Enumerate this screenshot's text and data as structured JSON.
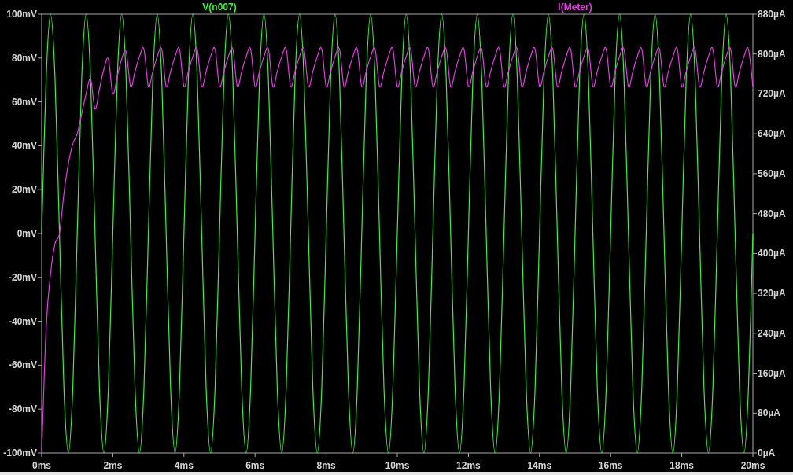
{
  "plot": {
    "chart_data": {
      "type": "line",
      "xlim": [
        0,
        20
      ],
      "xticks": [
        {
          "value": 0,
          "label": "0ms"
        },
        {
          "value": 2,
          "label": "2ms"
        },
        {
          "value": 4,
          "label": "4ms"
        },
        {
          "value": 6,
          "label": "6ms"
        },
        {
          "value": 8,
          "label": "8ms"
        },
        {
          "value": 10,
          "label": "10ms"
        },
        {
          "value": 12,
          "label": "12ms"
        },
        {
          "value": 14,
          "label": "14ms"
        },
        {
          "value": 16,
          "label": "16ms"
        },
        {
          "value": 18,
          "label": "18ms"
        },
        {
          "value": 20,
          "label": "20ms"
        }
      ],
      "ylim": [
        -100,
        100
      ],
      "yticks": [
        {
          "value": 100,
          "label": "100mV"
        },
        {
          "value": 80,
          "label": "80mV"
        },
        {
          "value": 60,
          "label": "60mV"
        },
        {
          "value": 40,
          "label": "40mV"
        },
        {
          "value": 20,
          "label": "20mV"
        },
        {
          "value": 0,
          "label": "0mV"
        },
        {
          "value": -20,
          "label": "-20mV"
        },
        {
          "value": -40,
          "label": "-40mV"
        },
        {
          "value": -60,
          "label": "-60mV"
        },
        {
          "value": -80,
          "label": "-80mV"
        },
        {
          "value": -100,
          "label": "-100mV"
        }
      ],
      "y2lim": [
        0,
        880
      ],
      "y2ticks": [
        {
          "value": 880,
          "label": "880µA"
        },
        {
          "value": 800,
          "label": "800µA"
        },
        {
          "value": 720,
          "label": "720µA"
        },
        {
          "value": 640,
          "label": "640µA"
        },
        {
          "value": 560,
          "label": "560µA"
        },
        {
          "value": 480,
          "label": "480µA"
        },
        {
          "value": 400,
          "label": "400µA"
        },
        {
          "value": 320,
          "label": "320µA"
        },
        {
          "value": 240,
          "label": "240µA"
        },
        {
          "value": 160,
          "label": "160µA"
        },
        {
          "value": 80,
          "label": "80µA"
        },
        {
          "value": 0,
          "label": "0µA"
        }
      ],
      "x": [
        0,
        0.125,
        0.25,
        0.375,
        0.5,
        0.625,
        0.75,
        0.875,
        1,
        1.125,
        1.25,
        1.375,
        1.5,
        1.625,
        1.75,
        1.875,
        2,
        2.125,
        2.25,
        2.375,
        2.5,
        2.625,
        2.75,
        2.875,
        3,
        3.125,
        3.25,
        3.375,
        3.5,
        3.625,
        3.75,
        3.875,
        4,
        4.125,
        4.25,
        4.375,
        4.5,
        4.625,
        4.75,
        4.875,
        5,
        5.125,
        5.25,
        5.375,
        5.5,
        5.625,
        5.75,
        5.875,
        6,
        6.125,
        6.25,
        6.375,
        6.5,
        6.625,
        6.75,
        6.875,
        7,
        7.125,
        7.25,
        7.375,
        7.5,
        7.625,
        7.75,
        7.875,
        8,
        8.125,
        8.25,
        8.375,
        8.5,
        8.625,
        8.75,
        8.875,
        9,
        9.125,
        9.25,
        9.375,
        9.5,
        9.625,
        9.75,
        9.875,
        10,
        10.125,
        10.25,
        10.375,
        10.5,
        10.625,
        10.75,
        10.875,
        11,
        11.125,
        11.25,
        11.375,
        11.5,
        11.625,
        11.75,
        11.875,
        12,
        12.125,
        12.25,
        12.375,
        12.5,
        12.625,
        12.75,
        12.875,
        13,
        13.125,
        13.25,
        13.375,
        13.5,
        13.625,
        13.75,
        13.875,
        14,
        14.125,
        14.25,
        14.375,
        14.5,
        14.625,
        14.75,
        14.875,
        15,
        15.125,
        15.25,
        15.375,
        15.5,
        15.625,
        15.75,
        15.875,
        16,
        16.125,
        16.25,
        16.375,
        16.5,
        16.625,
        16.75,
        16.875,
        17,
        17.125,
        17.25,
        17.375,
        17.5,
        17.625,
        17.75,
        17.875,
        18,
        18.125,
        18.25,
        18.375,
        18.5,
        18.625,
        18.75,
        18.875,
        19,
        19.125,
        19.25,
        19.375,
        19.5,
        19.625,
        19.75,
        19.875,
        20
      ],
      "series": [
        {
          "name": "V(n007)",
          "color": "#3ef03e",
          "values": [
            0,
            70.7,
            100,
            70.7,
            0,
            -70.7,
            -100,
            -70.7,
            0,
            70.7,
            100,
            70.7,
            0,
            -70.7,
            -100,
            -70.7,
            0,
            70.7,
            100,
            70.7,
            0,
            -70.7,
            -100,
            -70.7,
            0,
            70.7,
            100,
            70.7,
            0,
            -70.7,
            -100,
            -70.7,
            0,
            70.7,
            100,
            70.7,
            0,
            -70.7,
            -100,
            -70.7,
            0,
            70.7,
            100,
            70.7,
            0,
            -70.7,
            -100,
            -70.7,
            0,
            70.7,
            100,
            70.7,
            0,
            -70.7,
            -100,
            -70.7,
            0,
            70.7,
            100,
            70.7,
            0,
            -70.7,
            -100,
            -70.7,
            0,
            70.7,
            100,
            70.7,
            0,
            -70.7,
            -100,
            -70.7,
            0,
            70.7,
            100,
            70.7,
            0,
            -70.7,
            -100,
            -70.7,
            0,
            70.7,
            100,
            70.7,
            0,
            -70.7,
            -100,
            -70.7,
            0,
            70.7,
            100,
            70.7,
            0,
            -70.7,
            -100,
            -70.7,
            0,
            70.7,
            100,
            70.7,
            0,
            -70.7,
            -100,
            -70.7,
            0,
            70.7,
            100,
            70.7,
            0,
            -70.7,
            -100,
            -70.7,
            0,
            70.7,
            100,
            70.7,
            0,
            -70.7,
            -100,
            -70.7,
            0,
            70.7,
            100,
            70.7,
            0,
            -70.7,
            -100,
            -70.7,
            0,
            70.7,
            100,
            70.7,
            0,
            -70.7,
            -100,
            -70.7,
            0,
            70.7,
            100,
            70.7,
            0,
            -70.7,
            -100,
            -70.7,
            0,
            70.7,
            100,
            70.7,
            0,
            -70.7,
            -100,
            -70.7,
            0,
            70.7,
            100,
            70.7,
            0,
            -70.7,
            -100,
            -70.7,
            0
          ]
        },
        {
          "name": "I(Meter)",
          "color": "#e23ce2",
          "axis": "y2",
          "values": [
            0,
            250,
            360,
            420,
            440,
            520,
            580,
            620,
            640,
            680,
            720,
            750,
            690,
            730,
            770,
            790,
            720,
            755,
            790,
            805,
            735,
            765,
            795,
            810,
            735,
            765,
            795,
            810,
            735,
            765,
            795,
            810,
            735,
            765,
            795,
            810,
            735,
            765,
            795,
            810,
            735,
            765,
            795,
            810,
            735,
            765,
            795,
            810,
            735,
            765,
            795,
            810,
            735,
            765,
            795,
            810,
            735,
            765,
            795,
            810,
            735,
            765,
            795,
            810,
            735,
            765,
            795,
            810,
            735,
            765,
            795,
            810,
            735,
            765,
            795,
            810,
            735,
            765,
            795,
            810,
            735,
            765,
            795,
            810,
            735,
            765,
            795,
            810,
            735,
            765,
            795,
            810,
            735,
            765,
            795,
            810,
            735,
            765,
            795,
            810,
            735,
            765,
            795,
            810,
            735,
            765,
            795,
            810,
            735,
            765,
            795,
            810,
            735,
            765,
            795,
            810,
            735,
            765,
            795,
            810,
            735,
            765,
            795,
            810,
            735,
            765,
            795,
            810,
            735,
            765,
            795,
            810,
            735,
            765,
            795,
            810,
            735,
            765,
            795,
            810,
            735,
            765,
            795,
            810,
            735,
            765,
            795,
            810,
            735,
            765,
            795,
            810,
            735,
            765,
            795,
            810,
            735,
            765,
            795,
            810,
            735
          ]
        }
      ]
    }
  }
}
